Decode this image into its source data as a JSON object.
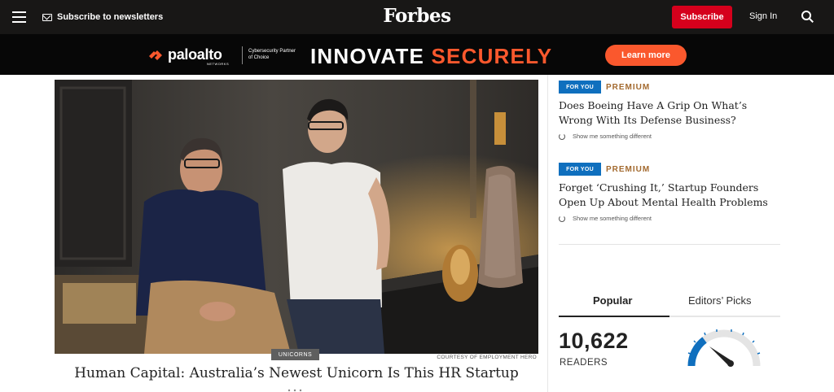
{
  "nav": {
    "subscribe_newsletters": "Subscribe to newsletters",
    "logo": "Forbes",
    "subscribe_button": "Subscribe",
    "sign_in": "Sign In"
  },
  "ad": {
    "brand": "paloalto",
    "brand_sub": "NETWORKS",
    "tagline": "Cybersecurity Partner of Choice",
    "headline_part1": "INNOVATE ",
    "headline_part2": "SECURELY",
    "cta": "Learn more",
    "accent_color": "#fa582d"
  },
  "article": {
    "tag": "UNICORNS",
    "credit": "COURTESY OF EMPLOYMENT HERO",
    "headline": "Human Capital: Australia’s Newest Unicorn Is This HR Startup"
  },
  "recommendations": [
    {
      "label": "FOR YOU",
      "premium": "PREMIUM",
      "title": "Does Boeing Have A Grip On What’s Wrong With Its Defense Business?",
      "action": "Show me something different"
    },
    {
      "label": "FOR YOU",
      "premium": "PREMIUM",
      "title": "Forget ‘Crushing It,’ Startup Founders Open Up About Mental Health Problems",
      "action": "Show me something different"
    }
  ],
  "tabs": {
    "popular": "Popular",
    "editors": "Editors’ Picks",
    "active": "popular"
  },
  "readers": {
    "count": "10,622",
    "label": "READERS"
  },
  "colors": {
    "nav_bg": "#181716",
    "subscribe_red": "#d5001c",
    "for_you_blue": "#0f6fbe",
    "premium_brown": "#a36a2f"
  }
}
